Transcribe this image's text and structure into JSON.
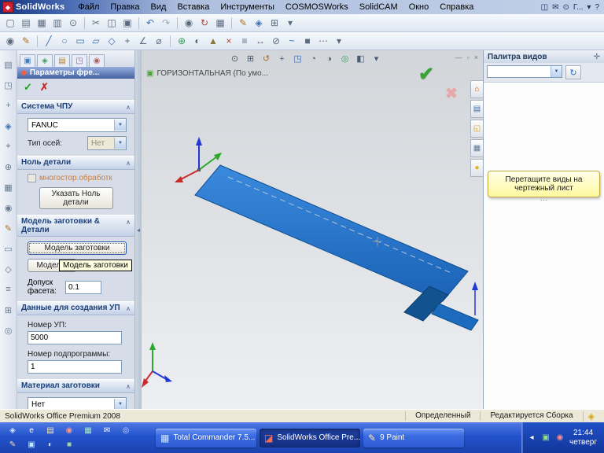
{
  "colors": {
    "titlebar_dark": "#12357f",
    "titlebar_light": "#c2d0e8",
    "toolbar_bg": "#e3eaf4",
    "panel_bg": "#d6dde8",
    "section_title_text": "#1a3f7a",
    "viewport_bg": "#d8dadd",
    "plate_blue": "#2176d2",
    "plate_edge": "#11508f",
    "hint_yellow": "#fff9a0",
    "taskbar_blue": "#2353cc",
    "status_bg": "#ece9d8",
    "ok_green": "#1f9e1f",
    "cancel_red": "#cc2a2a"
  },
  "ui": {
    "chevron_up": "∧",
    "dropdown": "▼",
    "splitter_grip": "◂"
  },
  "titlebar": {
    "logo_glyph": "◆",
    "app_title": "SolidWorks",
    "menu_items": [
      {
        "label": "Файл",
        "name": "menu-file"
      },
      {
        "label": "Правка",
        "name": "menu-edit"
      },
      {
        "label": "Вид",
        "name": "menu-view"
      },
      {
        "label": "Вставка",
        "name": "menu-insert"
      },
      {
        "label": "Инструменты",
        "name": "menu-tools"
      },
      {
        "label": "COSMOSWorks",
        "name": "menu-cosmosworks"
      },
      {
        "label": "SolidCAM",
        "name": "menu-solidcam"
      },
      {
        "label": "Окно",
        "name": "menu-window"
      },
      {
        "label": "Справка",
        "name": "menu-help"
      }
    ],
    "right_items": [
      {
        "glyph": "◫",
        "name": "window-split-icon"
      },
      {
        "glyph": "✉",
        "name": "feedback-icon"
      },
      {
        "glyph": "⊙",
        "name": "search-icon"
      },
      {
        "glyph": "Г...",
        "name": "doc-group-label"
      },
      {
        "glyph": "▾",
        "name": "chevron-down-icon"
      },
      {
        "glyph": "?",
        "name": "help-icon"
      }
    ]
  },
  "standard_toolbar": {
    "icons": [
      {
        "glyph": "▢",
        "name": "new-document-icon"
      },
      {
        "glyph": "▤",
        "name": "open-icon"
      },
      {
        "glyph": "▦",
        "name": "save-icon"
      },
      {
        "glyph": "▥",
        "name": "print-icon"
      },
      {
        "glyph": "⊙",
        "name": "print-preview-icon"
      },
      {
        "glyph": "",
        "class": "sep",
        "name": "separator"
      },
      {
        "glyph": "✂",
        "name": "cut-icon"
      },
      {
        "glyph": "◫",
        "name": "copy-icon"
      },
      {
        "glyph": "▣",
        "name": "paste-icon"
      },
      {
        "glyph": "",
        "class": "sep",
        "name": "separator"
      },
      {
        "glyph": "↶",
        "name": "undo-icon",
        "color": "#3f6fb8"
      },
      {
        "glyph": "↷",
        "name": "redo-icon",
        "color": "#9aa8ba"
      },
      {
        "glyph": "",
        "class": "sep",
        "name": "separator"
      },
      {
        "glyph": "◉",
        "name": "select-icon"
      },
      {
        "glyph": "↻",
        "name": "rebuild-icon",
        "color": "#b04030"
      },
      {
        "glyph": "▦",
        "name": "options-icon"
      },
      {
        "glyph": "",
        "class": "sep",
        "name": "separator"
      },
      {
        "glyph": "✎",
        "name": "sketch-icon",
        "color": "#b07020"
      },
      {
        "glyph": "◈",
        "name": "features-icon",
        "color": "#3b6fb0"
      },
      {
        "glyph": "⊞",
        "name": "grid-icon"
      },
      {
        "glyph": "▾",
        "name": "toolbar-options-icon"
      }
    ]
  },
  "sketch_toolbar": {
    "icons": [
      {
        "glyph": "◉",
        "name": "select-tool-icon"
      },
      {
        "glyph": "✎",
        "name": "sketch-tool-icon",
        "color": "#b07020"
      },
      {
        "glyph": "",
        "class": "sep",
        "name": "separator"
      },
      {
        "glyph": "╱",
        "name": "line-tool-icon",
        "color": "#3b6fb0"
      },
      {
        "glyph": "○",
        "name": "circle-tool-icon",
        "color": "#3b6fb0"
      },
      {
        "glyph": "▭",
        "name": "rectangle-tool-icon",
        "color": "#3b6fb0"
      },
      {
        "glyph": "▱",
        "name": "parallelogram-tool-icon",
        "color": "#3b6fb0"
      },
      {
        "glyph": "◇",
        "name": "polygon-tool-icon",
        "color": "#3b6fb0"
      },
      {
        "glyph": "+",
        "name": "point-tool-icon"
      },
      {
        "glyph": "∠",
        "name": "angle-dimension-icon"
      },
      {
        "glyph": "⌀",
        "name": "diameter-dimension-icon"
      },
      {
        "glyph": "",
        "class": "sep",
        "name": "separator"
      },
      {
        "glyph": "⊕",
        "name": "relations-icon",
        "color": "#3fa05f"
      },
      {
        "glyph": "◐",
        "name": "shaded-view-icon"
      },
      {
        "glyph": "▲",
        "name": "extrude-icon",
        "color": "#8a7a40"
      },
      {
        "glyph": "×",
        "name": "trim-icon",
        "color": "#b04030"
      },
      {
        "glyph": "≡",
        "name": "linear-pattern-icon"
      },
      {
        "glyph": "↔",
        "name": "mirror-icon"
      },
      {
        "glyph": "⊘",
        "name": "no-solve-icon"
      },
      {
        "glyph": "~",
        "name": "spline-tool-icon",
        "color": "#3b6fb0"
      },
      {
        "glyph": "■",
        "name": "fill-icon"
      },
      {
        "glyph": "⋯",
        "name": "more-tools-icon"
      },
      {
        "glyph": "▾",
        "name": "toolbar-options-icon"
      }
    ]
  },
  "left_toolbar": {
    "icons": [
      {
        "glyph": "▤",
        "name": "feature-tree-icon"
      },
      {
        "glyph": "◳",
        "name": "orientation-icon"
      },
      {
        "glyph": "+",
        "name": "add-component-icon"
      },
      {
        "glyph": "◈",
        "name": "mate-icon",
        "color": "#3b6fb0"
      },
      {
        "glyph": "⌖",
        "name": "move-component-icon"
      },
      {
        "glyph": "⊕",
        "name": "rotate-component-icon"
      },
      {
        "glyph": "▦",
        "name": "pattern-icon"
      },
      {
        "glyph": "◉",
        "name": "smart-fasteners-icon"
      },
      {
        "glyph": "✎",
        "name": "edit-component-icon",
        "color": "#b07020"
      },
      {
        "glyph": "▭",
        "name": "section-view-icon"
      },
      {
        "glyph": "◇",
        "name": "exploded-view-icon"
      },
      {
        "glyph": "≡",
        "name": "interference-icon"
      },
      {
        "glyph": "⊞",
        "name": "assembly-grid-icon"
      },
      {
        "glyph": "◎",
        "name": "simulation-icon"
      }
    ]
  },
  "property_panel": {
    "title": "Параметры фре...",
    "title_icon": "◆",
    "ok_glyph": "✓",
    "cancel_glyph": "✗",
    "tabs": [
      {
        "glyph": "▣",
        "color": "#3f7fbf",
        "name": "propertymanager-tab"
      },
      {
        "glyph": "◈",
        "color": "#3fa05f",
        "name": "featuremanager-tab"
      },
      {
        "glyph": "▤",
        "color": "#b08030",
        "name": "configurationmanager-tab"
      },
      {
        "glyph": "◳",
        "color": "#7f5fa0",
        "name": "dimxpert-tab"
      },
      {
        "glyph": "◉",
        "color": "#b05f5f",
        "name": "displaymanager-tab"
      }
    ],
    "cnc": {
      "title": "Система ЧПУ",
      "controller": "FANUC",
      "axis_label": "Тип осей:",
      "axis_value": "Нет"
    },
    "zero": {
      "title": "Ноль детали",
      "option": "многостор.обработк",
      "button": "Указать Ноль детали"
    },
    "model": {
      "title": "Модель заготовки & Детали",
      "stock_button": "Модель заготовки",
      "part_button": "Модел...",
      "tooltip": "Модель заготовки",
      "tolerance_label": "Допуск фасета:",
      "tolerance_value": "0.1"
    },
    "program": {
      "title": "Данные для создания УП",
      "np_label": "Номер УП:",
      "np_value": "5000",
      "sub_label": "Номер подпрограммы:",
      "sub_value": "1"
    },
    "material": {
      "title": "Материал заготовки",
      "value": "Нет"
    }
  },
  "viewport": {
    "orientation": "ГОРИЗОНТАЛЬНАЯ (По умо...",
    "orientation_icon": "▣",
    "ok_glyph": "✔",
    "cancel_glyph": "✖",
    "hud_icons": [
      {
        "glyph": "⊙",
        "name": "zoom-icon"
      },
      {
        "glyph": "⊞",
        "name": "zoom-to-area-icon"
      },
      {
        "glyph": "↺",
        "name": "rotate-view-icon",
        "color": "#b07020"
      },
      {
        "glyph": "+",
        "name": "pan-icon"
      },
      {
        "glyph": "◳",
        "name": "view-orientation-icon",
        "color": "#3b6fb0"
      },
      {
        "glyph": "◔",
        "name": "display-style-icon"
      },
      {
        "glyph": "◑",
        "name": "hide-show-icon"
      },
      {
        "glyph": "◎",
        "name": "appearance-icon",
        "color": "#3fa05f"
      },
      {
        "glyph": "◧",
        "name": "scene-icon"
      },
      {
        "glyph": "▾",
        "name": "chevron-down-icon"
      }
    ],
    "controls": [
      {
        "glyph": "—",
        "name": "minimize-icon"
      },
      {
        "glyph": "▫",
        "name": "restore-icon"
      },
      {
        "glyph": "×",
        "name": "close-icon"
      }
    ]
  },
  "task_pane": {
    "title": "Палитра видов",
    "pin_glyph": "✛",
    "combo_value": "",
    "refresh_glyph": "↻",
    "hint": "Перетащите виды на чертежный лист",
    "dots": "···",
    "tabs": [
      {
        "glyph": "⌂",
        "color": "#c86a1e",
        "name": "solidworks-resources-tab"
      },
      {
        "glyph": "▤",
        "color": "#3b6fb0",
        "name": "design-library-tab"
      },
      {
        "glyph": "◱",
        "color": "#d8a62a",
        "name": "file-explorer-tab"
      },
      {
        "glyph": "▦",
        "color": "#5a7a9c",
        "name": "view-palette-tab"
      },
      {
        "glyph": "●",
        "color": "#e0b020",
        "name": "appearances-tab"
      }
    ]
  },
  "status_bar": {
    "product": "SolidWorks Office Premium 2008",
    "state": "Определенный",
    "mode": "Редактируется Сборка",
    "icon": "◈"
  },
  "taskbar": {
    "quick_launch": [
      {
        "glyph": "◈",
        "color": "#cfe4ff",
        "name": "quicklaunch-icon-1"
      },
      {
        "glyph": "e",
        "color": "#ffffff",
        "name": "quicklaunch-ie-icon"
      },
      {
        "glyph": "▤",
        "color": "#ffe9a8",
        "name": "quicklaunch-explorer-icon"
      },
      {
        "glyph": "◉",
        "color": "#ff9a8a",
        "name": "quicklaunch-icon-2"
      },
      {
        "glyph": "▦",
        "color": "#a8e8c0",
        "name": "quicklaunch-icon-3"
      },
      {
        "glyph": "✉",
        "color": "#ffffff",
        "name": "quicklaunch-mail-icon"
      },
      {
        "glyph": "◎",
        "color": "#d0d8ff",
        "name": "quicklaunch-icon-4"
      },
      {
        "glyph": "✎",
        "color": "#ffd9a8",
        "name": "quicklaunch-icon-5"
      },
      {
        "glyph": "▣",
        "color": "#c0e8ff",
        "name": "quicklaunch-icon-6"
      },
      {
        "glyph": "◐",
        "color": "#e8e8e8",
        "name": "quicklaunch-icon-7"
      },
      {
        "glyph": "■",
        "color": "#9fd4a0",
        "name": "quicklaunch-icon-8"
      }
    ],
    "buttons": [
      {
        "label": "Total Commander 7.5...",
        "glyph": "▦",
        "color": "#cfe4ff",
        "name": "task-total-commander"
      },
      {
        "label": "SolidWorks Office Pre...",
        "glyph": "◪",
        "color": "#ff6a4a",
        "active": true,
        "name": "task-solidworks"
      },
      {
        "label": "9 Paint",
        "glyph": "✎",
        "color": "#ffe9a8",
        "name": "task-paint"
      }
    ],
    "tray_icons": [
      {
        "glyph": "◂",
        "color": "#ffffff",
        "name": "collapse-tray-icon"
      },
      {
        "glyph": "▣",
        "color": "#8fe08f",
        "name": "tray-status-icon-1"
      },
      {
        "glyph": "◉",
        "color": "#ff8f8f",
        "name": "tray-status-icon-2"
      }
    ],
    "time": "21:44",
    "day": "четверг"
  }
}
